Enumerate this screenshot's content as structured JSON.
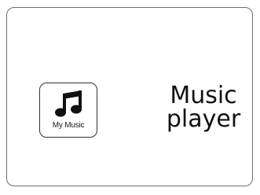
{
  "app_icon": {
    "icon": "music-note-icon",
    "label": "My Music"
  },
  "title": {
    "line1": "Music",
    "line2": "player"
  },
  "colors": {
    "background": "#ffffff",
    "border": "#6f6f6f",
    "text": "#111111"
  }
}
